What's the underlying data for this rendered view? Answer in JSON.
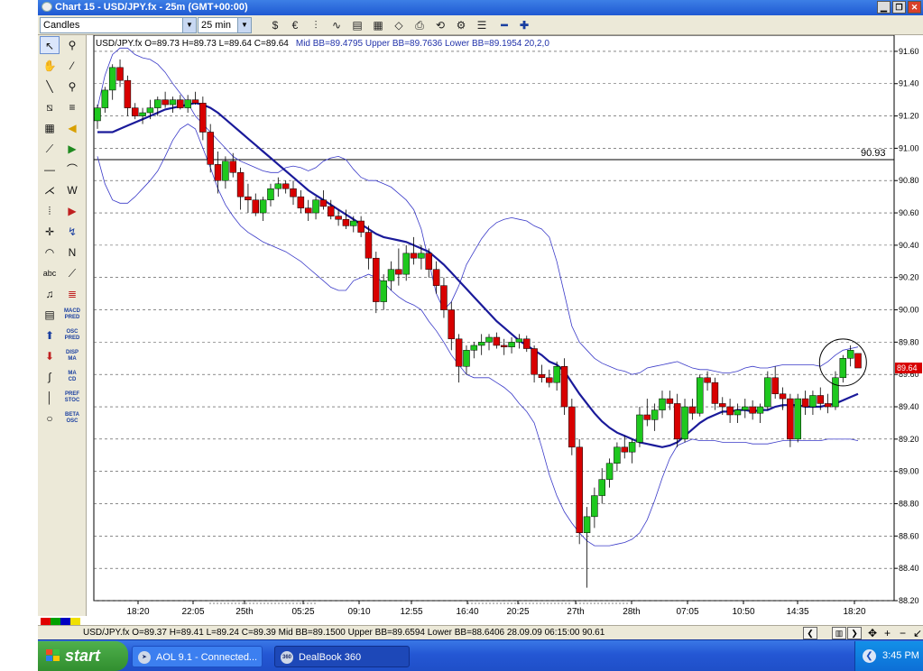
{
  "window": {
    "title": "Chart 15 - USD/JPY.fx - 25m (GMT+00:00)"
  },
  "toolbar": {
    "chart_type": "Candles",
    "interval": "25 min"
  },
  "chart": {
    "info_top": "USD/JPY.fx O=89.73 H=89.73 L=89.64 C=89.64",
    "bb_info_top": "Mid BB=89.4795 Upper BB=89.7636 Lower BB=89.1954  20,2,0",
    "info_bottom": "USD/JPY.fx O=89.37 H=89.41 L=89.24 C=89.39  Mid BB=89.1500 Upper BB=89.6594 Lower BB=88.6406  28.09.09 06:15:00 90.61",
    "hline_label": "90.93",
    "current_price_label": "89.64"
  },
  "chart_data": {
    "type": "candlestick",
    "symbol": "USD/JPY.fx",
    "interval": "25 min",
    "ylim": [
      88.2,
      91.7
    ],
    "yticks": [
      "91.60",
      "91.40",
      "91.20",
      "91.00",
      "90.80",
      "90.60",
      "90.40",
      "90.20",
      "90.00",
      "89.80",
      "89.60",
      "89.40",
      "89.20",
      "89.00",
      "88.80",
      "88.60",
      "88.40",
      "88.20"
    ],
    "xticks": [
      "18:20",
      "22:05",
      "25th",
      "05:25",
      "09:10",
      "12:55",
      "16:40",
      "20:25",
      "27th",
      "28th",
      "07:05",
      "10:50",
      "14:35",
      "18:20"
    ],
    "horizontal_line": 90.93,
    "last_price": 89.64,
    "grid": true,
    "candles": [
      [
        91.17,
        91.27,
        91.12,
        91.25
      ],
      [
        91.25,
        91.38,
        91.22,
        91.36
      ],
      [
        91.36,
        91.52,
        91.3,
        91.5
      ],
      [
        91.5,
        91.55,
        91.38,
        91.42
      ],
      [
        91.42,
        91.45,
        91.2,
        91.25
      ],
      [
        91.25,
        91.28,
        91.18,
        91.2
      ],
      [
        91.2,
        91.25,
        91.15,
        91.22
      ],
      [
        91.22,
        91.3,
        91.18,
        91.25
      ],
      [
        91.25,
        91.32,
        91.2,
        91.3
      ],
      [
        91.3,
        91.35,
        91.25,
        91.27
      ],
      [
        91.27,
        91.32,
        91.22,
        91.3
      ],
      [
        91.3,
        91.33,
        91.24,
        91.25
      ],
      [
        91.25,
        91.33,
        91.22,
        91.3
      ],
      [
        91.3,
        91.35,
        91.27,
        91.28
      ],
      [
        91.28,
        91.32,
        91.05,
        91.1
      ],
      [
        91.1,
        91.15,
        90.85,
        90.9
      ],
      [
        90.9,
        90.98,
        90.72,
        90.8
      ],
      [
        90.8,
        90.95,
        90.75,
        90.92
      ],
      [
        90.92,
        90.97,
        90.82,
        90.85
      ],
      [
        90.85,
        90.88,
        90.62,
        90.7
      ],
      [
        90.7,
        90.78,
        90.6,
        90.68
      ],
      [
        90.68,
        90.72,
        90.58,
        90.6
      ],
      [
        90.6,
        90.7,
        90.55,
        90.68
      ],
      [
        90.68,
        90.78,
        90.64,
        90.75
      ],
      [
        90.75,
        90.82,
        90.7,
        90.78
      ],
      [
        90.78,
        90.8,
        90.72,
        90.75
      ],
      [
        90.75,
        90.8,
        90.65,
        90.7
      ],
      [
        90.7,
        90.74,
        90.6,
        90.63
      ],
      [
        90.63,
        90.68,
        90.55,
        90.6
      ],
      [
        90.6,
        90.7,
        90.56,
        90.68
      ],
      [
        90.68,
        90.74,
        90.62,
        90.64
      ],
      [
        90.64,
        90.68,
        90.56,
        90.58
      ],
      [
        90.58,
        90.62,
        90.52,
        90.56
      ],
      [
        90.56,
        90.62,
        90.5,
        90.52
      ],
      [
        90.52,
        90.58,
        90.48,
        90.55
      ],
      [
        90.55,
        90.58,
        90.45,
        90.48
      ],
      [
        90.48,
        90.52,
        90.25,
        90.32
      ],
      [
        90.32,
        90.36,
        89.98,
        90.05
      ],
      [
        90.05,
        90.22,
        90.0,
        90.18
      ],
      [
        90.18,
        90.3,
        90.12,
        90.25
      ],
      [
        90.25,
        90.38,
        90.15,
        90.22
      ],
      [
        90.22,
        90.4,
        90.18,
        90.35
      ],
      [
        90.35,
        90.45,
        90.28,
        90.32
      ],
      [
        90.32,
        90.4,
        90.25,
        90.35
      ],
      [
        90.35,
        90.38,
        90.2,
        90.25
      ],
      [
        90.25,
        90.3,
        90.1,
        90.15
      ],
      [
        90.15,
        90.2,
        89.95,
        90.0
      ],
      [
        90.0,
        90.05,
        89.75,
        89.82
      ],
      [
        89.82,
        89.85,
        89.55,
        89.65
      ],
      [
        89.65,
        89.78,
        89.6,
        89.75
      ],
      [
        89.75,
        89.8,
        89.7,
        89.78
      ],
      [
        89.78,
        89.85,
        89.72,
        89.8
      ],
      [
        89.8,
        89.85,
        89.75,
        89.83
      ],
      [
        89.83,
        89.86,
        89.76,
        89.78
      ],
      [
        89.78,
        89.82,
        89.72,
        89.77
      ],
      [
        89.77,
        89.83,
        89.73,
        89.8
      ],
      [
        89.8,
        89.85,
        89.76,
        89.82
      ],
      [
        89.82,
        89.84,
        89.74,
        89.76
      ],
      [
        89.76,
        89.78,
        89.55,
        89.6
      ],
      [
        89.6,
        89.66,
        89.55,
        89.58
      ],
      [
        89.58,
        89.63,
        89.52,
        89.55
      ],
      [
        89.55,
        89.68,
        89.5,
        89.65
      ],
      [
        89.65,
        89.7,
        89.35,
        89.4
      ],
      [
        89.4,
        89.45,
        89.1,
        89.15
      ],
      [
        89.15,
        89.2,
        88.55,
        88.62
      ],
      [
        88.62,
        88.78,
        88.28,
        88.72
      ],
      [
        88.72,
        88.9,
        88.65,
        88.85
      ],
      [
        88.85,
        89.02,
        88.8,
        88.95
      ],
      [
        88.95,
        89.08,
        88.9,
        89.05
      ],
      [
        89.05,
        89.18,
        89.0,
        89.15
      ],
      [
        89.15,
        89.22,
        89.08,
        89.12
      ],
      [
        89.12,
        89.2,
        89.05,
        89.18
      ],
      [
        89.18,
        89.4,
        89.15,
        89.35
      ],
      [
        89.35,
        89.45,
        89.28,
        89.32
      ],
      [
        89.32,
        89.42,
        89.25,
        89.38
      ],
      [
        89.38,
        89.5,
        89.33,
        89.45
      ],
      [
        89.45,
        89.5,
        89.38,
        89.42
      ],
      [
        89.42,
        89.48,
        89.15,
        89.2
      ],
      [
        89.2,
        89.45,
        89.18,
        89.4
      ],
      [
        89.4,
        89.45,
        89.32,
        89.36
      ],
      [
        89.36,
        89.6,
        89.34,
        89.58
      ],
      [
        89.58,
        89.62,
        89.5,
        89.55
      ],
      [
        89.55,
        89.58,
        89.38,
        89.42
      ],
      [
        89.42,
        89.46,
        89.35,
        89.4
      ],
      [
        89.4,
        89.45,
        89.3,
        89.35
      ],
      [
        89.35,
        89.42,
        89.3,
        89.38
      ],
      [
        89.38,
        89.45,
        89.33,
        89.4
      ],
      [
        89.4,
        89.44,
        89.32,
        89.36
      ],
      [
        89.36,
        89.42,
        89.3,
        89.4
      ],
      [
        89.4,
        89.62,
        89.38,
        89.58
      ],
      [
        89.58,
        89.65,
        89.45,
        89.48
      ],
      [
        89.48,
        89.52,
        89.38,
        89.45
      ],
      [
        89.45,
        89.48,
        89.15,
        89.2
      ],
      [
        89.2,
        89.48,
        89.18,
        89.45
      ],
      [
        89.45,
        89.5,
        89.35,
        89.4
      ],
      [
        89.4,
        89.5,
        89.35,
        89.47
      ],
      [
        89.47,
        89.52,
        89.38,
        89.42
      ],
      [
        89.42,
        89.48,
        89.36,
        89.4
      ],
      [
        89.4,
        89.62,
        89.38,
        89.58
      ],
      [
        89.58,
        89.72,
        89.55,
        89.7
      ],
      [
        89.7,
        89.78,
        89.65,
        89.75
      ],
      [
        89.73,
        89.73,
        89.64,
        89.64
      ]
    ],
    "mid_bb": [
      91.1,
      91.1,
      91.1,
      91.12,
      91.14,
      91.16,
      91.18,
      91.2,
      91.22,
      91.24,
      91.25,
      91.26,
      91.27,
      91.28,
      91.27,
      91.25,
      91.22,
      91.18,
      91.14,
      91.1,
      91.06,
      91.02,
      90.98,
      90.94,
      90.9,
      90.86,
      90.82,
      90.78,
      90.74,
      90.71,
      90.68,
      90.65,
      90.62,
      90.59,
      90.56,
      90.53,
      90.5,
      90.47,
      90.45,
      90.44,
      90.43,
      90.42,
      90.4,
      90.38,
      90.36,
      90.32,
      90.28,
      90.23,
      90.18,
      90.13,
      90.08,
      90.03,
      89.98,
      89.93,
      89.89,
      89.85,
      89.81,
      89.78,
      89.75,
      89.72,
      89.68,
      89.66,
      89.62,
      89.55,
      89.48,
      89.42,
      89.36,
      89.31,
      89.27,
      89.24,
      89.22,
      89.2,
      89.18,
      89.17,
      89.16,
      89.15,
      89.16,
      89.18,
      89.22,
      89.26,
      89.3,
      89.33,
      89.35,
      89.37,
      89.37,
      89.38,
      89.38,
      89.37,
      89.38,
      89.38,
      89.4,
      89.41,
      89.41,
      89.41,
      89.4,
      89.4,
      89.4,
      89.41,
      89.42,
      89.44,
      89.46,
      89.48
    ],
    "upper_bb": [
      91.25,
      91.45,
      91.58,
      91.62,
      91.62,
      91.58,
      91.56,
      91.55,
      91.52,
      91.47,
      91.4,
      91.34,
      91.28,
      91.2,
      91.15,
      91.1,
      91.05,
      91.0,
      90.95,
      90.92,
      90.9,
      90.88,
      90.86,
      90.85,
      90.85,
      90.88,
      90.89,
      90.88,
      90.86,
      90.88,
      90.92,
      90.94,
      90.95,
      90.93,
      90.87,
      90.82,
      90.8,
      90.8,
      90.78,
      90.76,
      90.72,
      90.68,
      90.62,
      90.5,
      90.3,
      90.1,
      90.0,
      90.05,
      90.15,
      90.28,
      90.36,
      90.44,
      90.5,
      90.54,
      90.56,
      90.57,
      90.56,
      90.55,
      90.52,
      90.5,
      90.45,
      90.3,
      90.1,
      89.9,
      89.8,
      89.75,
      89.7,
      89.67,
      89.65,
      89.63,
      89.62,
      89.6,
      89.61,
      89.64,
      89.65,
      89.66,
      89.67,
      89.68,
      89.66,
      89.64,
      89.63,
      89.63,
      89.62,
      89.61,
      89.61,
      89.62,
      89.64,
      89.65,
      89.64,
      89.64,
      89.65,
      89.66,
      89.66,
      89.66,
      89.66,
      89.66,
      89.65,
      89.68,
      89.72,
      89.75,
      89.76,
      89.77
    ],
    "lower_bb": [
      90.95,
      90.78,
      90.68,
      90.66,
      90.66,
      90.7,
      90.75,
      90.8,
      90.86,
      90.95,
      91.05,
      91.12,
      91.15,
      91.12,
      91.0,
      90.88,
      90.75,
      90.65,
      90.58,
      90.52,
      90.48,
      90.45,
      90.42,
      90.4,
      90.38,
      90.36,
      90.33,
      90.3,
      90.26,
      90.22,
      90.18,
      90.14,
      90.12,
      90.12,
      90.18,
      90.2,
      90.22,
      90.2,
      90.17,
      90.12,
      90.08,
      90.05,
      90.03,
      90.0,
      89.93,
      89.87,
      89.8,
      89.72,
      89.66,
      89.6,
      89.58,
      89.58,
      89.58,
      89.55,
      89.52,
      89.48,
      89.42,
      89.37,
      89.3,
      89.15,
      88.98,
      88.85,
      88.75,
      88.68,
      88.62,
      88.57,
      88.54,
      88.54,
      88.54,
      88.55,
      88.56,
      88.58,
      88.62,
      88.7,
      88.82,
      88.96,
      89.08,
      89.16,
      89.18,
      89.2,
      89.19,
      89.19,
      89.19,
      89.18,
      89.18,
      89.18,
      89.18,
      89.17,
      89.17,
      89.17,
      89.18,
      89.19,
      89.19,
      89.19,
      89.19,
      89.19,
      89.19,
      89.2,
      89.2,
      89.2,
      89.2,
      89.19
    ]
  },
  "statusbar": {
    "taskbar": {
      "start": "start",
      "task1": "AOL 9.1 - Connected...",
      "task2": "DealBook 360",
      "clock": "3:45 PM"
    }
  }
}
